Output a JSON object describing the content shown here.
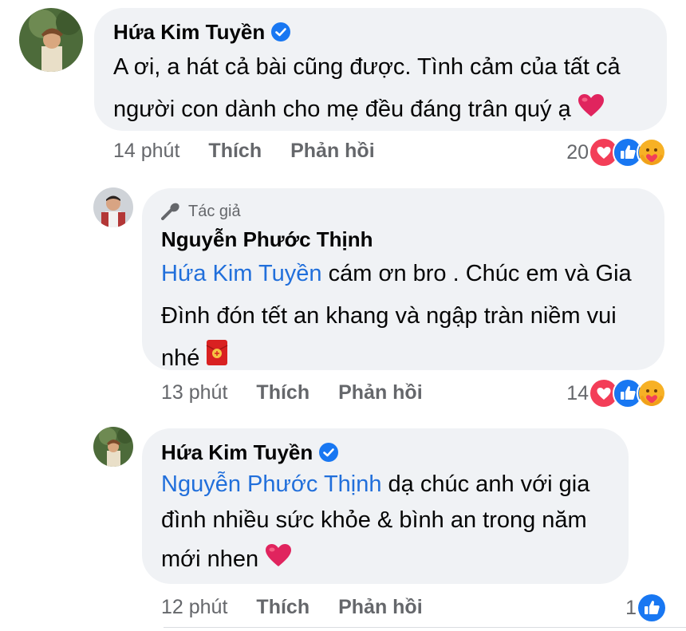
{
  "comments": [
    {
      "author": "Hứa Kim Tuyền",
      "verified": true,
      "text_line1": "A ơi, a hát cả bài cũng được. Tình cảm của tất cả",
      "text_line2": "người con dành cho mẹ đều đáng trân quý ạ",
      "emoji": "heart-emoji",
      "time": "14 phút",
      "like_label": "Thích",
      "reply_label": "Phản hồi",
      "reaction_count": "20",
      "reactions": [
        "love",
        "like",
        "care"
      ]
    },
    {
      "author_tag": "Tác giả",
      "author": "Nguyễn Phước Thịnh",
      "mention": "Hứa Kim Tuyền",
      "text_line1_rest": " cám ơn bro . Chúc em và Gia",
      "text_line2": "Đình đón tết an khang và ngập tràn niềm vui",
      "text_line3": "nhé",
      "emoji": "red-envelope-emoji",
      "time": "13 phút",
      "like_label": "Thích",
      "reply_label": "Phản hồi",
      "reaction_count": "14",
      "reactions": [
        "love",
        "like",
        "care"
      ]
    },
    {
      "author": "Hứa Kim Tuyền",
      "verified": true,
      "mention": "Nguyễn Phước Thịnh",
      "text_line1_rest": " dạ chúc anh với gia",
      "text_line2": "đình nhiều sức khỏe & bình an trong năm",
      "text_line3": "mới nhen",
      "emoji": "heart-emoji",
      "time": "12 phút",
      "like_label": "Thích",
      "reply_label": "Phản hồi",
      "reaction_count": "1",
      "reactions": [
        "like"
      ]
    }
  ],
  "colors": {
    "bubble": "#f0f2f5",
    "mention": "#216fdb",
    "meta": "#65676b",
    "verified": "#1877f2",
    "heart": "#e0245e"
  }
}
